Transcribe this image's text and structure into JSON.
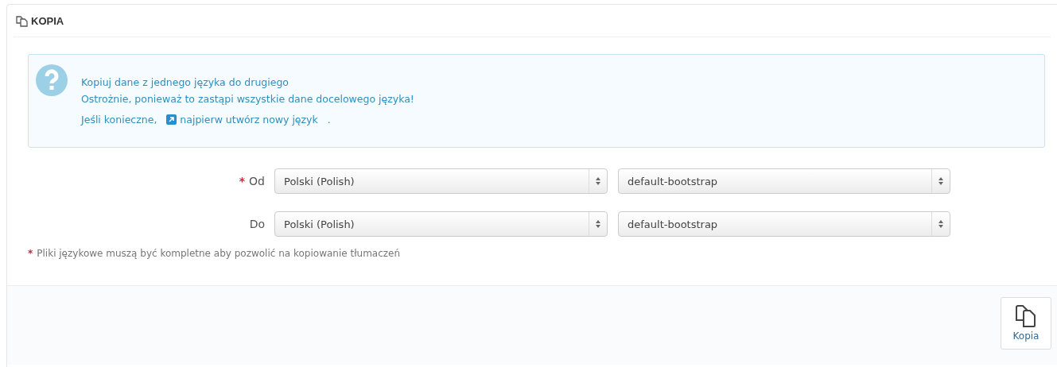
{
  "panel": {
    "title": "KOPIA"
  },
  "info": {
    "lines": [
      "Kopiuj dane z jednego języka do drugiego",
      "Ostrożnie, ponieważ to zastąpi wszystkie dane docelowego języka!"
    ],
    "prefix": "Jeśli konieczne,",
    "link": "najpierw utwórz nowy język",
    "suffix": "."
  },
  "fields": [
    {
      "label": "Od",
      "mark": "*",
      "language": "Polski (Polish)",
      "theme": "default-bootstrap"
    },
    {
      "label": "Do",
      "language": "Polski (Polish)",
      "theme": "default-bootstrap"
    }
  ],
  "note": {
    "mark": "*",
    "text": "Pliki językowe muszą być kompletne aby pozwolić na kopiowanie tłumaczeń"
  },
  "footer": {
    "button": "Kopia"
  }
}
